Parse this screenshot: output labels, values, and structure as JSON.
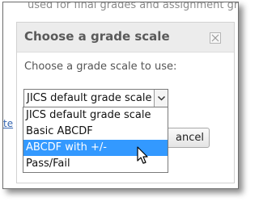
{
  "background": {
    "top_text": "used for final grades and assignment grade",
    "link_fragment": "te"
  },
  "dialog": {
    "title": "Choose a grade scale",
    "prompt": "Choose a grade scale to use:",
    "select": {
      "selected_value": "JICS default grade scale",
      "options": [
        "JICS default grade scale",
        "Basic ABCDF",
        "ABCDF with +/-",
        "Pass/Fail"
      ],
      "highlighted_index": 2
    },
    "cancel_label": "ancel"
  },
  "colors": {
    "highlight": "#3399ff",
    "header": "#ececec",
    "title": "#5a5a5a"
  },
  "icons": {
    "close": "close-icon",
    "dropdown_arrow": "chevron-down-icon",
    "cursor": "mouse-pointer-icon"
  }
}
